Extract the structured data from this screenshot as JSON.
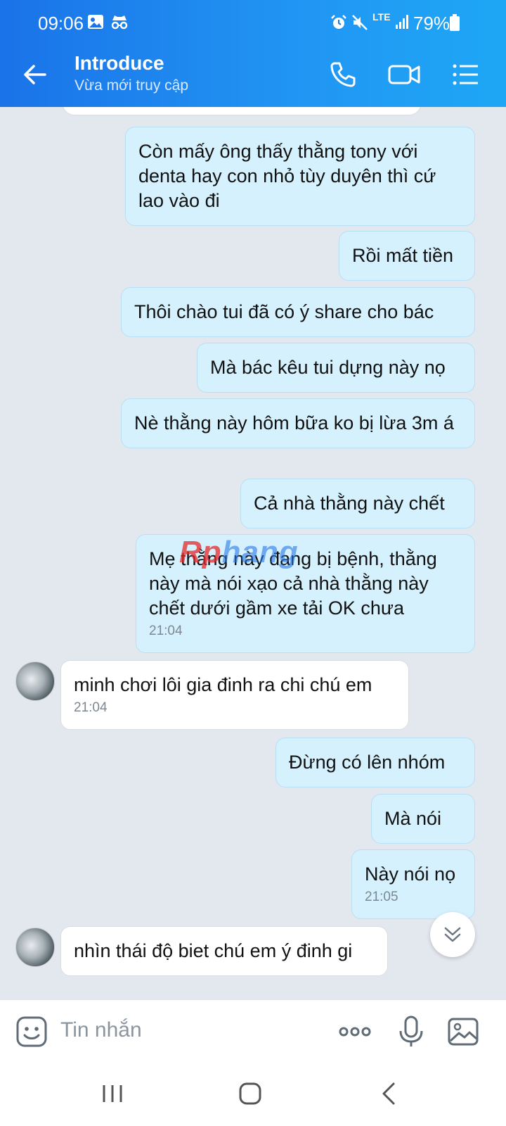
{
  "status_bar": {
    "time": "09:06",
    "network": "LTE",
    "battery": "79%"
  },
  "header": {
    "title": "Introduce",
    "subtitle": "Vừa mới truy cập"
  },
  "messages": [
    {
      "dir": "out",
      "text": "Còn mấy ông thấy thằng tony với denta hay con nhỏ tùy duyên thì cứ lao vào đi",
      "time": ""
    },
    {
      "dir": "out",
      "text": "Rồi mất tiền",
      "time": ""
    },
    {
      "dir": "out",
      "text": "Thôi chào tui đã có ý share cho bác",
      "time": ""
    },
    {
      "dir": "out",
      "text": "Mà bác kêu tui dựng này nọ",
      "time": ""
    },
    {
      "dir": "out",
      "text": "Nè thằng này hôm bữa ko bị lừa 3m á",
      "time": ""
    },
    {
      "dir": "out",
      "text": "Cả nhà thằng này chết",
      "time": ""
    },
    {
      "dir": "out",
      "text": "Mẹ thằng này đang bị bệnh, thằng này mà nói xạo cả nhà thằng này chết dưới gầm xe tải OK chưa",
      "time": "21:04"
    },
    {
      "dir": "in",
      "text": "minh chơi lôi gia đinh ra chi chú em",
      "time": "21:04"
    },
    {
      "dir": "out",
      "text": "Đừng có lên nhóm",
      "time": ""
    },
    {
      "dir": "out",
      "text": "Mà nói",
      "time": ""
    },
    {
      "dir": "out",
      "text": "Này nói nọ",
      "time": "21:05"
    },
    {
      "dir": "in",
      "text": "nhìn thái độ biet chú em ý đinh gi",
      "time": ""
    }
  ],
  "watermark": {
    "part1": "Rp",
    "part2": "hang"
  },
  "input": {
    "placeholder": "Tin nhắn"
  },
  "colors": {
    "header": "#1a73e8",
    "bubble_out": "#d5f1fe",
    "bubble_in": "#ffffff",
    "background": "#e3e8ee"
  },
  "icons": [
    "back-arrow-icon",
    "phone-icon",
    "video-call-icon",
    "menu-list-icon",
    "sticker-icon",
    "more-dots-icon",
    "microphone-icon",
    "image-icon",
    "chevron-double-down-icon"
  ]
}
